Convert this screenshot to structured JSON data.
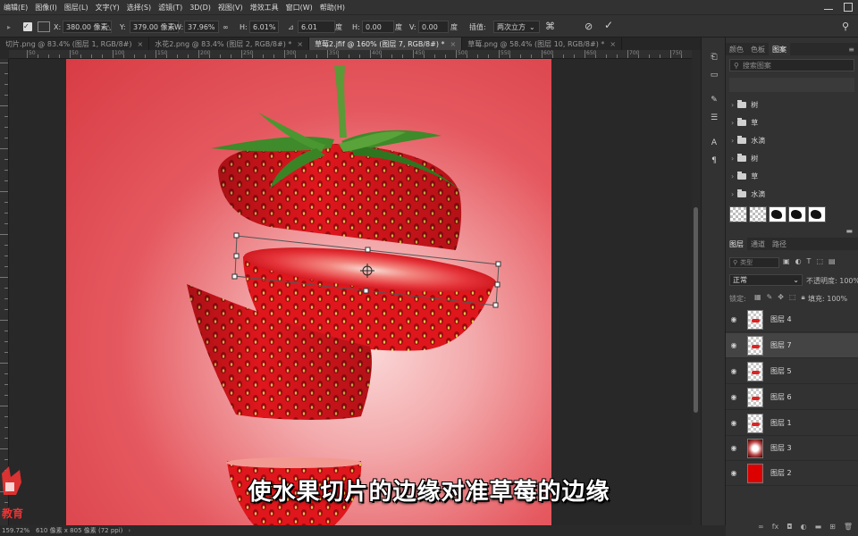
{
  "menu": {
    "items": [
      "编辑(E)",
      "图像(I)",
      "图层(L)",
      "文字(Y)",
      "选择(S)",
      "滤镜(T)",
      "3D(D)",
      "视图(V)",
      "增效工具",
      "窗口(W)",
      "帮助(H)"
    ]
  },
  "options": {
    "x_label": "X:",
    "x_value": "380.00 像素",
    "y_label": "Y:",
    "y_value": "379.00 像素",
    "w_label": "W:",
    "w_value": "37.96%",
    "h_label": "H:",
    "h_value": "6.01%",
    "angle_value": "6.01",
    "degree": "度",
    "hskew_label": "H:",
    "hskew_value": "0.00",
    "vskew_label": "V:",
    "vskew_value": "0.00",
    "interp_label": "插值:",
    "interp_value": "两次立方"
  },
  "tabs": [
    {
      "label": "切片.png @ 83.4% (图层 1, RGB/8#)",
      "active": false
    },
    {
      "label": "水花2.png @ 83.4% (图层 2, RGB/8#) *",
      "active": false
    },
    {
      "label": "草莓2.jfif @ 160% (图层 7, RGB/8#) *",
      "active": true
    },
    {
      "label": "草莓.png @ 58.4% (图层 10, RGB/8#) *",
      "active": false
    }
  ],
  "ruler": {
    "labels": [
      "50",
      "50",
      "100",
      "150",
      "200",
      "250",
      "300",
      "350",
      "400",
      "450",
      "500",
      "550",
      "600",
      "650",
      "700",
      "750"
    ]
  },
  "status": {
    "zoom": "159.72%",
    "doc_info": "610 像素 x 805 像素 (72 ppi)"
  },
  "panels": {
    "top_tabs": [
      "颜色",
      "色板",
      "图案"
    ],
    "search_placeholder": "搜索图案",
    "library_items": [
      "树",
      "草",
      "水滴",
      "树",
      "草",
      "水滴"
    ],
    "layer_tabs": [
      "图层",
      "通道",
      "路径"
    ],
    "kind_placeholder": "类型",
    "blend_mode": "正常",
    "opacity_label": "不透明度:",
    "opacity_value": "100%",
    "lock_label": "锁定:",
    "fill_label": "填充:",
    "fill_value": "100%"
  },
  "layers": [
    {
      "name": "图层 4",
      "thumb": "blob",
      "selected": false
    },
    {
      "name": "图层 7",
      "thumb": "blob",
      "selected": true
    },
    {
      "name": "图层 5",
      "thumb": "blob",
      "selected": false
    },
    {
      "name": "图层 6",
      "thumb": "blob",
      "selected": false
    },
    {
      "name": "图层 1",
      "thumb": "blob",
      "selected": false
    },
    {
      "name": "图层 3",
      "thumb": "glow",
      "selected": false
    },
    {
      "name": "图层 2",
      "thumb": "red",
      "selected": false
    }
  ],
  "subtitle": "使水果切片的边缘对准草莓的边缘",
  "watermark": "教育",
  "colors": {
    "strawberry": "#e0161d",
    "background": "#e5585f",
    "leaf": "#3f8a2a",
    "ui_dark": "#323232"
  }
}
